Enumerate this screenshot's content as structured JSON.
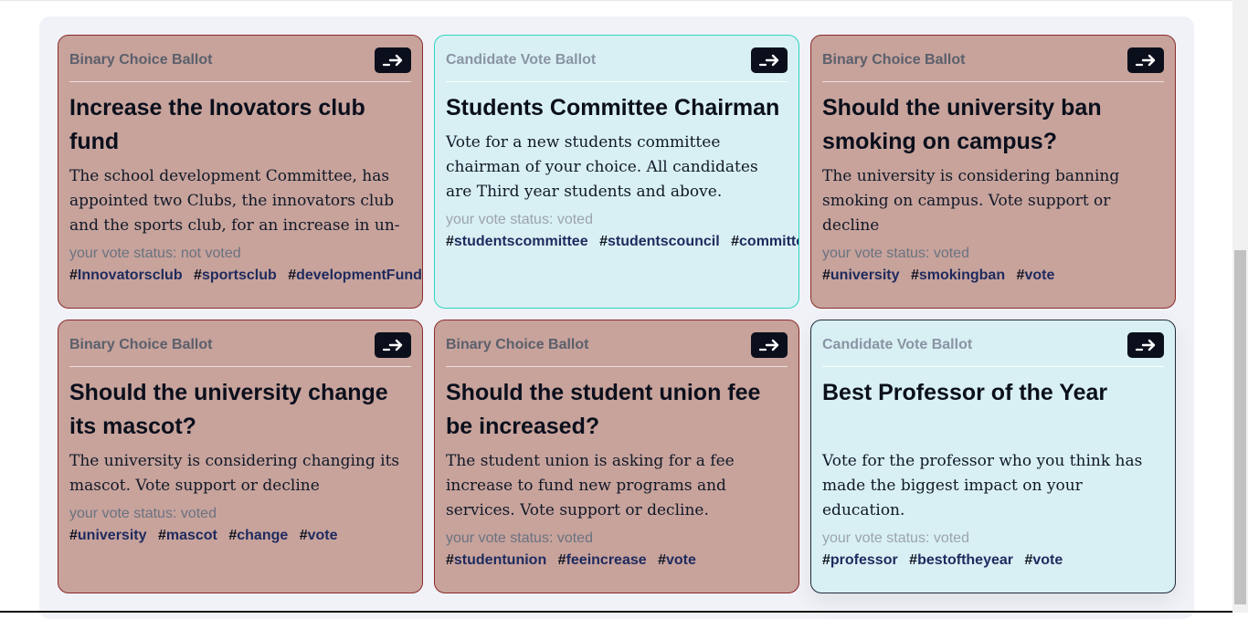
{
  "ballots": [
    {
      "type_label": "Binary Choice Ballot",
      "title": "Increase the Inovators club fund",
      "description": "The school development Committee, has appointed two Clubs, the innovators club and the sports club, for an increase in un-",
      "status": "your vote status: not voted",
      "tags": [
        "Innovatorsclub",
        "sportsclub",
        "developmentFund"
      ]
    },
    {
      "type_label": "Candidate Vote Ballot",
      "title": "Students Committee Chairman",
      "description": "Vote for a new students committee chairman of your choice. All candidates are Third year students and above.",
      "status": "your vote status: voted",
      "tags": [
        "studentscommittee",
        "studentscouncil",
        "committee"
      ]
    },
    {
      "type_label": "Binary Choice Ballot",
      "title": "Should the university ban smoking on campus?",
      "description": "The university is considering banning smoking on campus. Vote support or decline",
      "status": "your vote status: voted",
      "tags": [
        "university",
        "smokingban",
        "vote"
      ]
    },
    {
      "type_label": "Binary Choice Ballot",
      "title": "Should the university change its mascot?",
      "description": "The university is considering changing its mascot. Vote support or decline",
      "status": "your vote status: voted",
      "tags": [
        "university",
        "mascot",
        "change",
        "vote"
      ]
    },
    {
      "type_label": "Binary Choice Ballot",
      "title": "Should the student union fee be increased?",
      "description": "The student union is asking for a fee increase to fund new programs and services. Vote support or decline.",
      "status": "your vote status: voted",
      "tags": [
        "studentunion",
        "feeincrease",
        "vote"
      ]
    },
    {
      "type_label": "Candidate Vote Ballot",
      "title": "Best Professor of the Year",
      "description": "Vote for the professor who you think has made the biggest impact on your education.",
      "status": "your vote status: voted",
      "tags": [
        "professor",
        "bestoftheyear",
        "vote"
      ]
    }
  ],
  "colors": {
    "binary_bg": "#c7a39c",
    "binary_border": "#8b2a2a",
    "candidate_bg": "#d8f0f4",
    "candidate_border": "#2dd4bf",
    "button_bg": "#0b0f1c"
  },
  "icons": {
    "open_button": "arrow-right-icon"
  }
}
